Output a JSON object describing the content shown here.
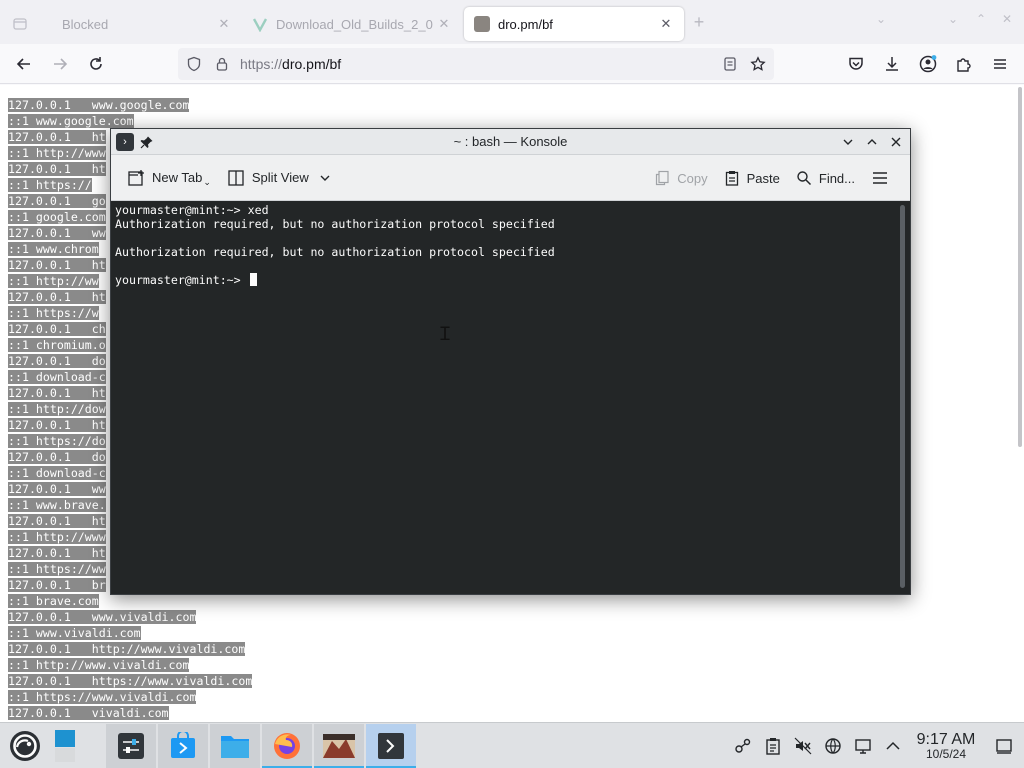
{
  "browser": {
    "tabs": [
      {
        "title": "Blocked",
        "active": false
      },
      {
        "title": "Download_Old_Builds_2_0",
        "active": false
      },
      {
        "title": "dro.pm/bf",
        "active": true
      }
    ],
    "url_prefix": "https://",
    "url_host": "dro.pm/bf"
  },
  "page": {
    "hosts_lines": [
      "127.0.0.1   www.google.com",
      "::1 www.google.com",
      "127.0.0.1   ht",
      "::1 http://www",
      "127.0.0.1   ht",
      "::1 https://",
      "127.0.0.1   go",
      "::1 google.com",
      "127.0.0.1   ww",
      "::1 www.chrom",
      "127.0.0.1   ht",
      "::1 http://ww",
      "127.0.0.1   ht",
      "::1 https://w",
      "127.0.0.1   ch",
      "::1 chromium.o",
      "127.0.0.1   do",
      "::1 download-c",
      "127.0.0.1   ht",
      "::1 http://dow",
      "127.0.0.1   ht",
      "::1 https://do",
      "127.0.0.1   do",
      "::1 download-c",
      "127.0.0.1   ww",
      "::1 www.brave.",
      "127.0.0.1   ht",
      "::1 http://www",
      "127.0.0.1   ht",
      "::1 https://ww",
      "127.0.0.1   br",
      "::1 brave.com",
      "127.0.0.1   www.vivaldi.com",
      "::1 www.vivaldi.com",
      "127.0.0.1   http://www.vivaldi.com",
      "::1 http://www.vivaldi.com",
      "127.0.0.1   https://www.vivaldi.com",
      "::1 https://www.vivaldi.com",
      "127.0.0.1   vivaldi.com"
    ]
  },
  "konsole": {
    "title": "~ : bash — Konsole",
    "toolbar": {
      "new_tab": "New Tab",
      "split_view": "Split View",
      "copy": "Copy",
      "paste": "Paste",
      "find": "Find..."
    },
    "terminal": {
      "line1": "yourmaster@mint:~> xed",
      "line2": "Authorization required, but no authorization protocol specified",
      "line3": "",
      "line4": "Authorization required, but no authorization protocol specified",
      "line5": "",
      "prompt": "yourmaster@mint:~> "
    }
  },
  "taskbar": {
    "time": "9:17 AM",
    "date": "10/5/24"
  },
  "colors": {
    "terminal_bg": "#232627",
    "accent": "#3daee9"
  }
}
